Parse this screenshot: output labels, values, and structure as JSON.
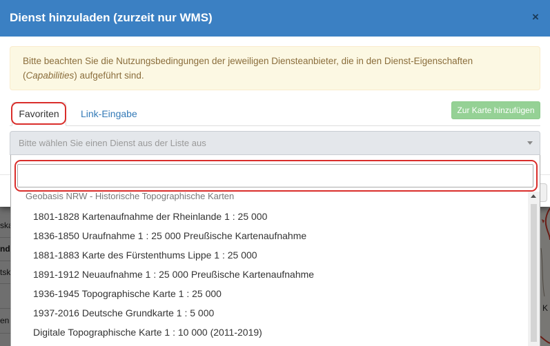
{
  "modal": {
    "title": "Dienst hinzuladen (zurzeit nur WMS)",
    "close_glyph": "×",
    "close_icon": "close-icon"
  },
  "alert": {
    "line1": "Bitte beachten Sie die Nutzungsbedingungen der jeweiligen Diensteanbieter, die in den Dienst-Eigenschaften",
    "term_prefix": "(",
    "term": "Capabilities",
    "term_suffix": ") aufgeführt sind."
  },
  "tabs": [
    {
      "label": "Favoriten",
      "active": true
    },
    {
      "label": "Link-Eingabe",
      "active": false
    }
  ],
  "add_to_map_button": {
    "label": "Zur Karte hinzufügen",
    "disabled": true
  },
  "service_select": {
    "placeholder": "Bitte wählen Sie einen Dienst aus der Liste aus",
    "open": true,
    "caret_icon": "caret-down-icon",
    "search_value": ""
  },
  "dropdown": {
    "group_label": "Geobasis NRW - Historische Topographische Karten",
    "options": [
      "1801-1828 Kartenaufnahme der Rheinlande 1 : 25 000",
      "1836-1850 Uraufnahme 1 : 25 000 Preußische Kartenaufnahme",
      "1881-1883 Karte des Fürstenthums Lippe 1 : 25 000",
      "1891-1912 Neuaufnahme 1 : 25 000 Preußische Kartenaufnahme",
      "1936-1945 Topographische Karte 1 : 25 000",
      "1937-2016 Deutsche Grundkarte 1 : 5 000",
      "Digitale Topographische Karte 1 : 10 000 (2011-2019)"
    ],
    "scroll_up_icon": "scroll-up-arrow-icon"
  },
  "background": {
    "side_panel_fragments": [
      "ska",
      "nd",
      "tsk",
      "en"
    ],
    "map_label": "K"
  },
  "colors": {
    "header": "#3b80c3",
    "alert_background": "#fcf8e3",
    "alert_border": "#faebcc",
    "alert_text": "#8a6d3b",
    "link": "#337ab7",
    "add_button": "#95d195",
    "select_background": "#e4e7eb",
    "annotation": "#d92d2a"
  }
}
